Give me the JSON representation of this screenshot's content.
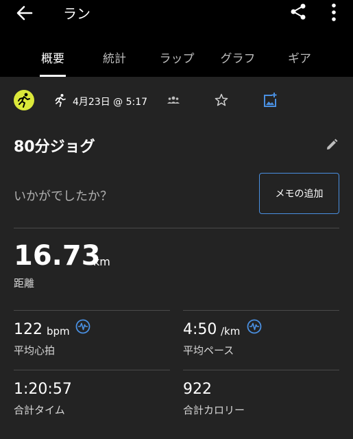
{
  "header": {
    "title": "ラン",
    "icons": {
      "back": "arrow-left-icon",
      "share": "share-icon",
      "more": "more-vert-icon"
    }
  },
  "tabs": [
    {
      "label": "概要",
      "active": true
    },
    {
      "label": "統計",
      "active": false
    },
    {
      "label": "ラップ",
      "active": false
    },
    {
      "label": "グラフ",
      "active": false
    },
    {
      "label": "ギア",
      "active": false
    }
  ],
  "info": {
    "date": "4月23日 @ 5:17",
    "icons": [
      "runner-badge-icon",
      "run-icon",
      "group-icon",
      "star-icon",
      "add-photo-icon"
    ]
  },
  "activity": {
    "name": "80分ジョグ",
    "feeling_prompt": "いかがでしたか？",
    "memo_button": "メモの追加"
  },
  "stats": {
    "distance": {
      "value": "16.73",
      "unit": "km",
      "label": "距離"
    },
    "avg_hr": {
      "value": "122",
      "unit": "bpm",
      "label": "平均心拍"
    },
    "avg_pace": {
      "value": "4:50",
      "unit": "/km",
      "label": "平均ペース"
    },
    "total_time": {
      "value": "1:20:57",
      "label": "合計タイム"
    },
    "total_calories": {
      "value": "922",
      "label": "合計カロリー"
    }
  },
  "colors": {
    "background": "#232323",
    "topbar": "#000000",
    "accent_blue": "#4a90e2",
    "badge_yellow": "#dbe83a"
  }
}
